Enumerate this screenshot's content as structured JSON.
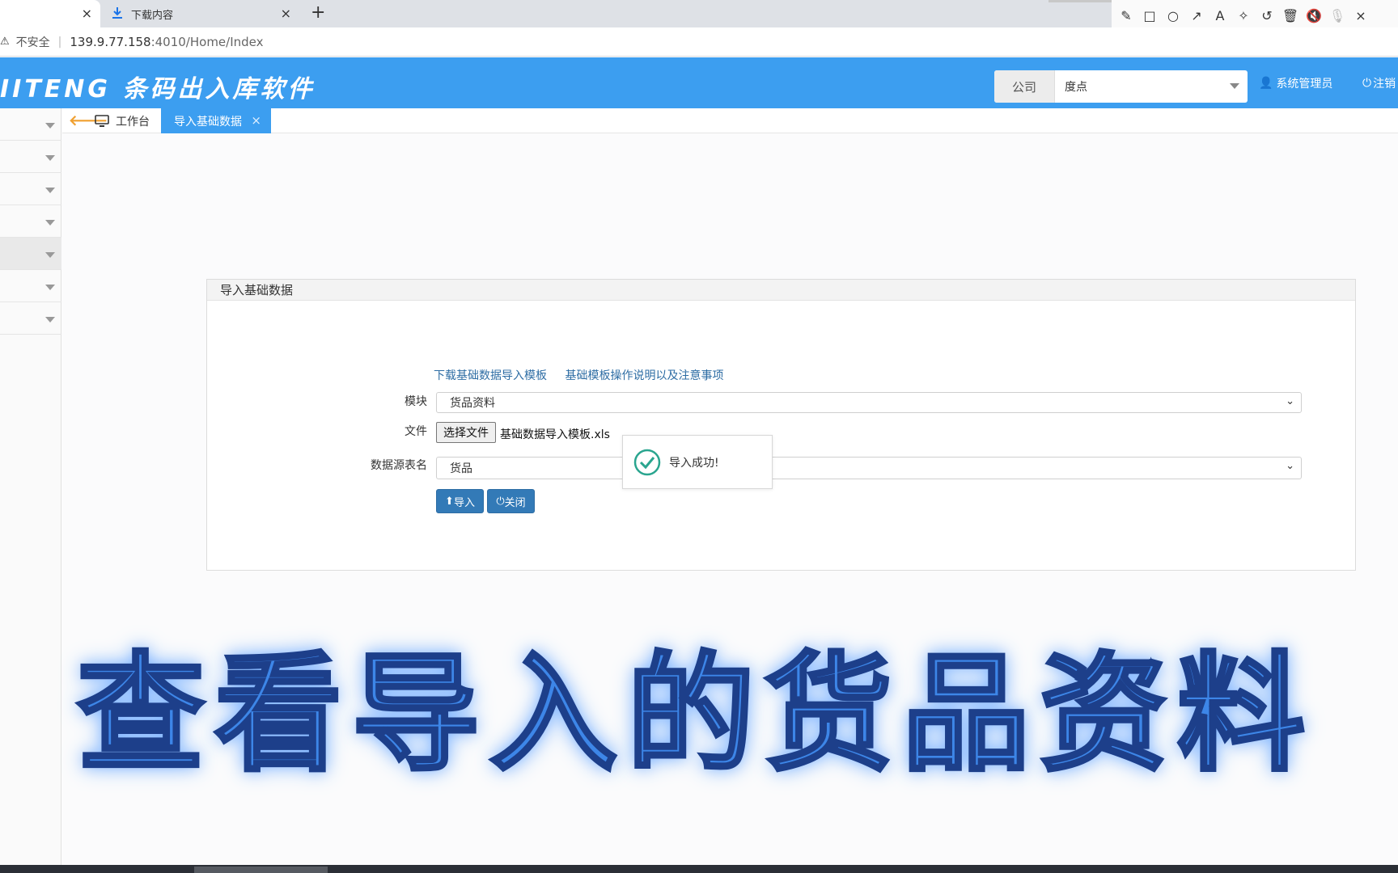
{
  "browser": {
    "active_tab_close": "×",
    "inactive_tab": {
      "title": "下载内容",
      "close": "×"
    },
    "new_tab": "+",
    "address": {
      "insecure": "不安全",
      "url_host": "139.9.77.158",
      "url_rest": ":4010/Home/Index"
    }
  },
  "app": {
    "brand": "IITENG 条码出入库软件",
    "company_label": "公司",
    "company_value": "度点",
    "user": "系统管理员",
    "logout": "注销"
  },
  "page_tabs": {
    "home": "工作台",
    "active": "导入基础数据",
    "active_close": "×"
  },
  "panel": {
    "title": "导入基础数据",
    "link_template": "下载基础数据导入模板",
    "link_instructions": "基础模板操作说明以及注意事项",
    "module_label": "模块",
    "module_value": "货品资料",
    "file_label": "文件",
    "file_button": "选择文件",
    "file_name": "基础数据导入模板.xls",
    "source_label": "数据源表名",
    "source_value": "货品",
    "import_button": "导入",
    "close_button": "关闭"
  },
  "toast": {
    "message": "导入成功!"
  },
  "caption": "查看导入的货品资料"
}
